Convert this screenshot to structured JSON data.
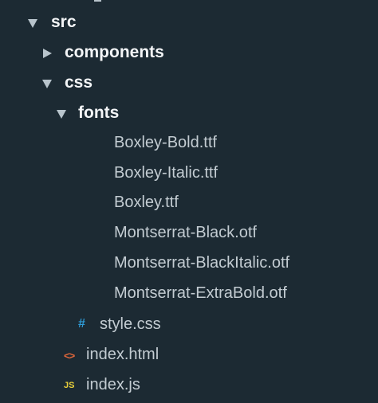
{
  "tree": {
    "src": {
      "label": "src",
      "expanded": true,
      "icon": "chevron-down-icon"
    },
    "components": {
      "label": "components",
      "expanded": false,
      "icon": "chevron-right-icon"
    },
    "css": {
      "label": "css",
      "expanded": true,
      "icon": "chevron-down-icon"
    },
    "fonts": {
      "label": "fonts",
      "expanded": true,
      "icon": "chevron-down-icon"
    },
    "font_files": [
      {
        "label": "Boxley-Bold.ttf"
      },
      {
        "label": "Boxley-Italic.ttf"
      },
      {
        "label": "Boxley.ttf"
      },
      {
        "label": "Montserrat-Black.otf"
      },
      {
        "label": "Montserrat-BlackItalic.otf"
      },
      {
        "label": "Montserrat-ExtraBold.otf"
      }
    ],
    "style_css": {
      "label": "style.css",
      "icon_text": "#",
      "icon": "css-hash-icon",
      "icon_color": "#2e9bd6"
    },
    "index_html": {
      "label": "index.html",
      "icon_text": "<>",
      "icon": "html-code-icon",
      "icon_color": "#e2673a"
    },
    "index_js": {
      "label": "index.js",
      "icon_text": "JS",
      "icon": "js-file-icon",
      "icon_color": "#e8cf3b"
    }
  },
  "colors": {
    "background": "#1c2a33",
    "folder_text": "#f3f5f7",
    "file_text": "#c3ccd2",
    "arrow": "#b8c4cc"
  }
}
